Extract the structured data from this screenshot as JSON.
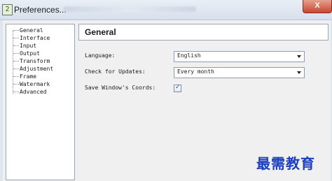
{
  "window": {
    "title": "Preferences...",
    "app_icon_glyph": "2",
    "close_label": "X"
  },
  "sidebar": {
    "items": [
      {
        "label": "General"
      },
      {
        "label": "Interface"
      },
      {
        "label": "Input"
      },
      {
        "label": "Output"
      },
      {
        "label": "Transform"
      },
      {
        "label": "Adjustment"
      },
      {
        "label": "Frame"
      },
      {
        "label": "Watermark"
      },
      {
        "label": "Advanced"
      }
    ]
  },
  "main": {
    "section_title": "General",
    "language": {
      "label": "Language:",
      "value": "English"
    },
    "updates": {
      "label": "Check for Updates:",
      "value": "Every month"
    },
    "save_coords": {
      "label": "Save Window's Coords:",
      "checked": true
    }
  },
  "overlay": {
    "watermark_text": "最需教育"
  },
  "colors": {
    "accent_text": "#1d3fbf",
    "close_button": "#c7472d"
  }
}
